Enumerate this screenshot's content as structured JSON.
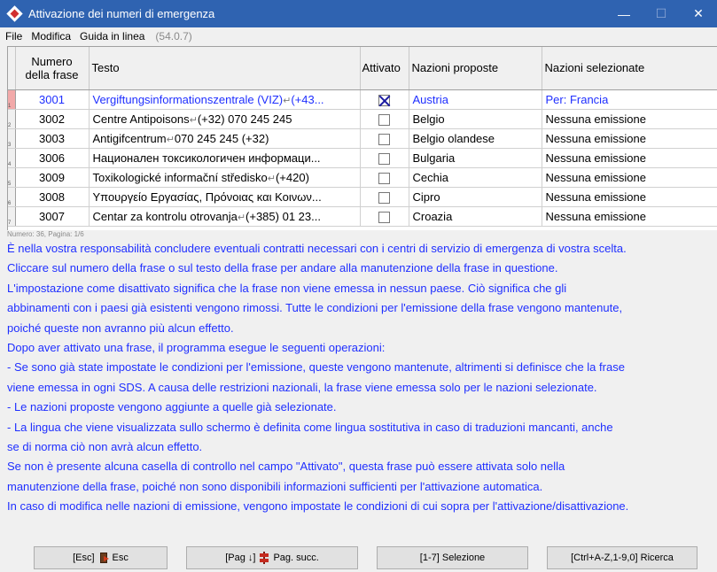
{
  "window": {
    "title": "Attivazione dei numeri di emergenza",
    "minimize_glyph": "—",
    "maximize_glyph": "☐",
    "close_glyph": "✕"
  },
  "menu": {
    "file": "File",
    "modifica": "Modifica",
    "guida": "Guida in linea",
    "version": "(54.0.7)"
  },
  "table": {
    "headers": {
      "numero": "Numero della frase",
      "testo": "Testo",
      "attivato": "Attivato",
      "proposte": "Nazioni proposte",
      "selezionate": "Nazioni selezionate"
    },
    "rows": [
      {
        "idx": "1",
        "numero": "3001",
        "testo": "Vergiftungsinformationszentrale (VIZ)",
        "testo2": "(+43...",
        "attivato": true,
        "proposte": "Austria",
        "selezionate": "Per: Francia"
      },
      {
        "idx": "2",
        "numero": "3002",
        "testo": "Centre Antipoisons",
        "testo2": "(+32) 070 245 245",
        "attivato": false,
        "proposte": "Belgio",
        "selezionate": "Nessuna emissione"
      },
      {
        "idx": "3",
        "numero": "3003",
        "testo": "Antigifcentrum",
        "testo2": "070 245 245 (+32)",
        "attivato": false,
        "proposte": "Belgio olandese",
        "selezionate": "Nessuna emissione"
      },
      {
        "idx": "4",
        "numero": "3006",
        "testo": "Национален токсикологичен информаци...",
        "testo2": "",
        "attivato": false,
        "proposte": "Bulgaria",
        "selezionate": "Nessuna emissione"
      },
      {
        "idx": "5",
        "numero": "3009",
        "testo": "Toxikologické informační středisko",
        "testo2": "(+420)",
        "attivato": false,
        "proposte": "Cechia",
        "selezionate": "Nessuna emissione"
      },
      {
        "idx": "6",
        "numero": "3008",
        "testo": "Υπουργείο Εργασίας, Πρόνοιας και Κοινων...",
        "testo2": "",
        "attivato": false,
        "proposte": "Cipro",
        "selezionate": "Nessuna emissione"
      },
      {
        "idx": "7",
        "numero": "3007",
        "testo": "Centar za kontrolu otrovanja",
        "testo2": "(+385) 01 23...",
        "attivato": false,
        "proposte": "Croazia",
        "selezionate": "Nessuna emissione"
      }
    ],
    "line_break_glyph": "↵",
    "footer": "Numero: 36, Pagina: 1/6"
  },
  "info_lines": [
    "È nella vostra responsabilità concludere eventuali contratti necessari con i centri di servizio di emergenza di vostra scelta.",
    "Cliccare sul numero della frase o sul testo della frase per andare alla manutenzione della frase in questione.",
    "L'impostazione come disattivato significa che la frase non viene emessa in nessun paese. Ciò significa che gli",
    "abbinamenti con i paesi già esistenti vengono rimossi. Tutte le condizioni per l'emissione della frase vengono mantenute,",
    "poiché queste non avranno più alcun effetto.",
    "Dopo aver attivato una frase, il programma esegue le seguenti operazioni:",
    "- Se sono già state impostate le condizioni per l'emissione, queste vengono mantenute, altrimenti si definisce che la frase",
    "viene emessa in ogni SDS. A causa delle restrizioni nazionali, la frase viene emessa solo per le nazioni selezionate.",
    "- Le nazioni proposte vengono aggiunte a quelle già selezionate.",
    "- La lingua che viene visualizzata sullo schermo è definita come lingua sostitutiva in caso di traduzioni mancanti, anche",
    "se di norma ciò non avrà alcun effetto.",
    "Se non è presente alcuna casella di controllo nel campo \"Attivato\", questa frase può essere attivata solo nella",
    "manutenzione della frase, poiché non sono disponibili informazioni sufficienti per l'attivazione automatica.",
    "In caso di modifica nelle nazioni di emissione, vengono impostate le condizioni di cui sopra per l'attivazione/disattivazione."
  ],
  "buttons": {
    "esc_key": "[Esc]",
    "esc_label": "Esc",
    "next_key": "[Pag ↓]",
    "next_label": "Pag. succ.",
    "select": "[1-7] Selezione",
    "search": "[Ctrl+A-Z,1-9,0] Ricerca"
  }
}
